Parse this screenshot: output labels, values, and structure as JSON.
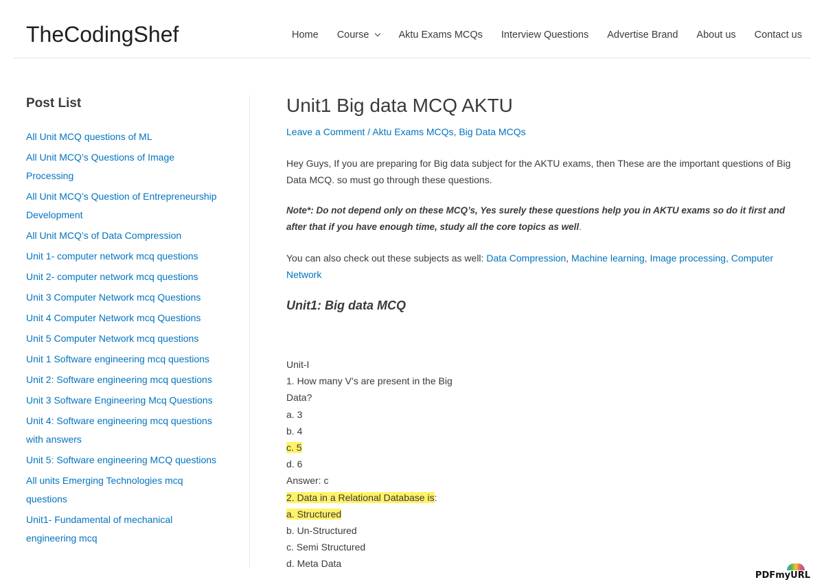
{
  "header": {
    "site_title": "TheCodingShef",
    "nav": [
      {
        "label": "Home"
      },
      {
        "label": "Course",
        "has_dropdown": true
      },
      {
        "label": "Aktu Exams MCQs"
      },
      {
        "label": "Interview Questions"
      },
      {
        "label": "Advertise Brand"
      },
      {
        "label": "About us"
      },
      {
        "label": "Contact us"
      }
    ]
  },
  "sidebar": {
    "title": "Post List",
    "posts": [
      "All Unit MCQ questions of ML",
      "All Unit MCQ’s Questions of Image Processing",
      "All Unit MCQ’s Question of Entrepreneurship Development",
      "All Unit MCQ’s of Data Compression",
      "Unit 1- computer network mcq questions",
      "Unit 2- computer network mcq questions",
      "Unit 3 Computer Network mcq Questions",
      "Unit 4 Computer Network mcq Questions",
      "Unit 5 Computer Network mcq questions",
      "Unit 1 Software engineering mcq questions",
      "Unit 2: Software engineering mcq questions",
      "Unit 3 Software Engineering Mcq Questions",
      "Unit 4: Software engineering mcq questions with answers",
      "Unit 5: Software engineering MCQ questions",
      "All units Emerging Technologies mcq questions",
      "Unit1- Fundamental of mechanical engineering mcq"
    ]
  },
  "article": {
    "title": "Unit1 Big data MCQ AKTU",
    "meta": {
      "comment_link": "Leave a Comment",
      "separator": " / ",
      "category1": "Aktu Exams MCQs",
      "comma": ", ",
      "category2": "Big Data MCQs"
    },
    "intro": "Hey Guys, If you are preparing for Big data subject for the AKTU exams, then These are the important questions of  Big Data MCQ. so must go through these questions.",
    "note": "Note*: Do not depend only on these MCQ’s, Yes surely these questions help you in AKTU exams so do it first and after that if you have enough time, study all the core topics as well",
    "note_end": ".",
    "subjects_prefix": "You can also check out these subjects as well: ",
    "subject_links": [
      "Data Compression",
      "Machine learning,",
      "Image processing,",
      "Computer Network"
    ],
    "subheading": "Unit1: Big data MCQ",
    "qa": {
      "unit": "Unit-I",
      "q1_line1": "1. How many V’s are present in the Big",
      "q1_line2": "Data?",
      "q1_a": "a. 3",
      "q1_b": "b. 4",
      "q1_c": "c. 5",
      "q1_d": "d. 6",
      "q1_answer": "Answer: c",
      "q2_text": "2. Data in a Relational Database is",
      "q2_colon": ":",
      "q2_a": "a. Structured",
      "q2_b": "b. Un-Structured",
      "q2_c": "c. Semi Structured",
      "q2_d": "d. Meta Data"
    }
  },
  "watermark": "PDFmyURL",
  "colors": {
    "link": "#0274be",
    "highlight": "#fff267",
    "text": "#3a3a3a"
  }
}
